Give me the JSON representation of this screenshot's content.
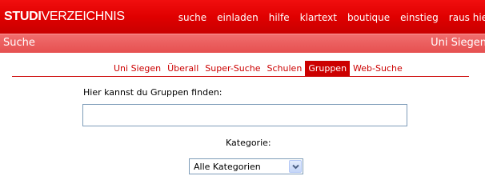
{
  "header": {
    "logo_bold": "STUDI",
    "logo_thin": "VERZEICHNIS",
    "nav": [
      "suche",
      "einladen",
      "hilfe",
      "klartext",
      "boutique",
      "einstieg",
      "raus hier"
    ]
  },
  "subheader": {
    "title": "Suche",
    "right": "Uni Siegen"
  },
  "tabs": [
    {
      "label": "Uni Siegen",
      "active": false
    },
    {
      "label": "Überall",
      "active": false
    },
    {
      "label": "Super-Suche",
      "active": false
    },
    {
      "label": "Schulen",
      "active": false
    },
    {
      "label": "Gruppen",
      "active": true
    },
    {
      "label": "Web-Suche",
      "active": false
    }
  ],
  "form": {
    "search_label": "Hier kannst du Gruppen finden:",
    "search_value": "",
    "category_label": "Kategorie:",
    "category_selected": "Alle Kategorien"
  },
  "colors": {
    "brand_red": "#cc0000",
    "header_red": "#e00000",
    "subbar_red": "#e65050"
  }
}
